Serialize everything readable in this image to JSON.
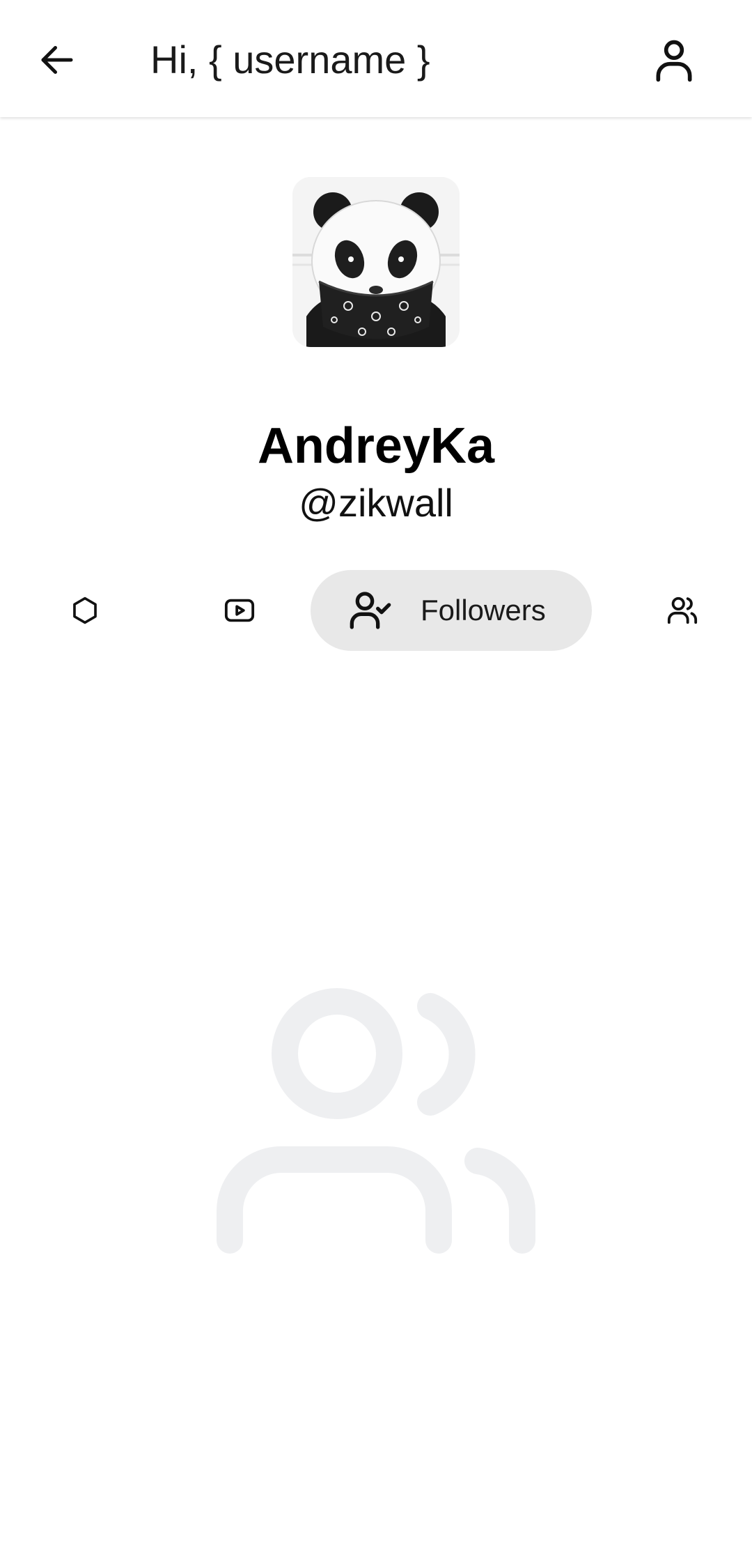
{
  "header": {
    "title": "Hi, { username }",
    "back_icon": "arrow-left-icon",
    "account_icon": "account-icon"
  },
  "profile": {
    "avatar": "panda-avatar",
    "display_name": "AndreyKa",
    "handle": "@zikwall"
  },
  "tabs": [
    {
      "icon": "hexagon-icon",
      "label": ""
    },
    {
      "icon": "video-play-icon",
      "label": ""
    },
    {
      "icon": "user-check-icon",
      "label": "Followers",
      "selected": true
    },
    {
      "icon": "users-icon",
      "label": ""
    }
  ],
  "empty_state": {
    "icon": "users-icon"
  },
  "colors": {
    "selected_tab_bg": "#e8e8e8",
    "empty_icon": "#eeeff1",
    "text": "#111111"
  }
}
